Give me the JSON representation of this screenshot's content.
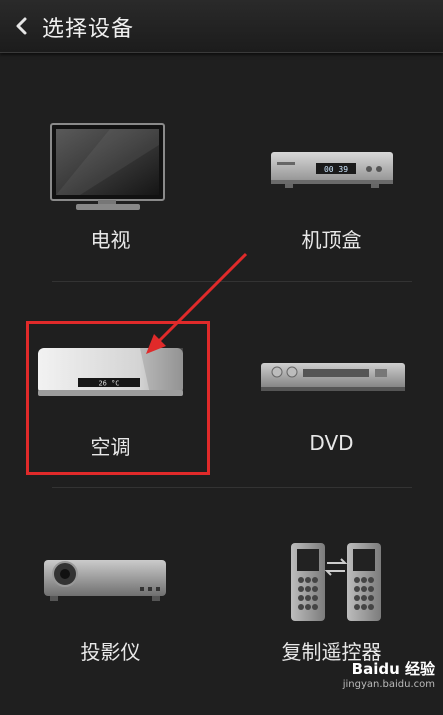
{
  "header": {
    "title": "选择设备",
    "back_icon": "chevron-left-icon"
  },
  "devices": [
    {
      "label": "电视",
      "icon": "tv-icon"
    },
    {
      "label": "机顶盒",
      "icon": "set-top-box-icon",
      "display": "00 39"
    },
    {
      "label": "空调",
      "icon": "air-conditioner-icon",
      "display": "26 °C"
    },
    {
      "label": "DVD",
      "icon": "dvd-player-icon"
    },
    {
      "label": "投影仪",
      "icon": "projector-icon"
    },
    {
      "label": "复制遥控器",
      "icon": "copy-remote-icon"
    }
  ],
  "annotation": {
    "color": "#e02a2a"
  },
  "watermark": {
    "logo": "Baidu 经验",
    "url": "jingyan.baidu.com"
  }
}
